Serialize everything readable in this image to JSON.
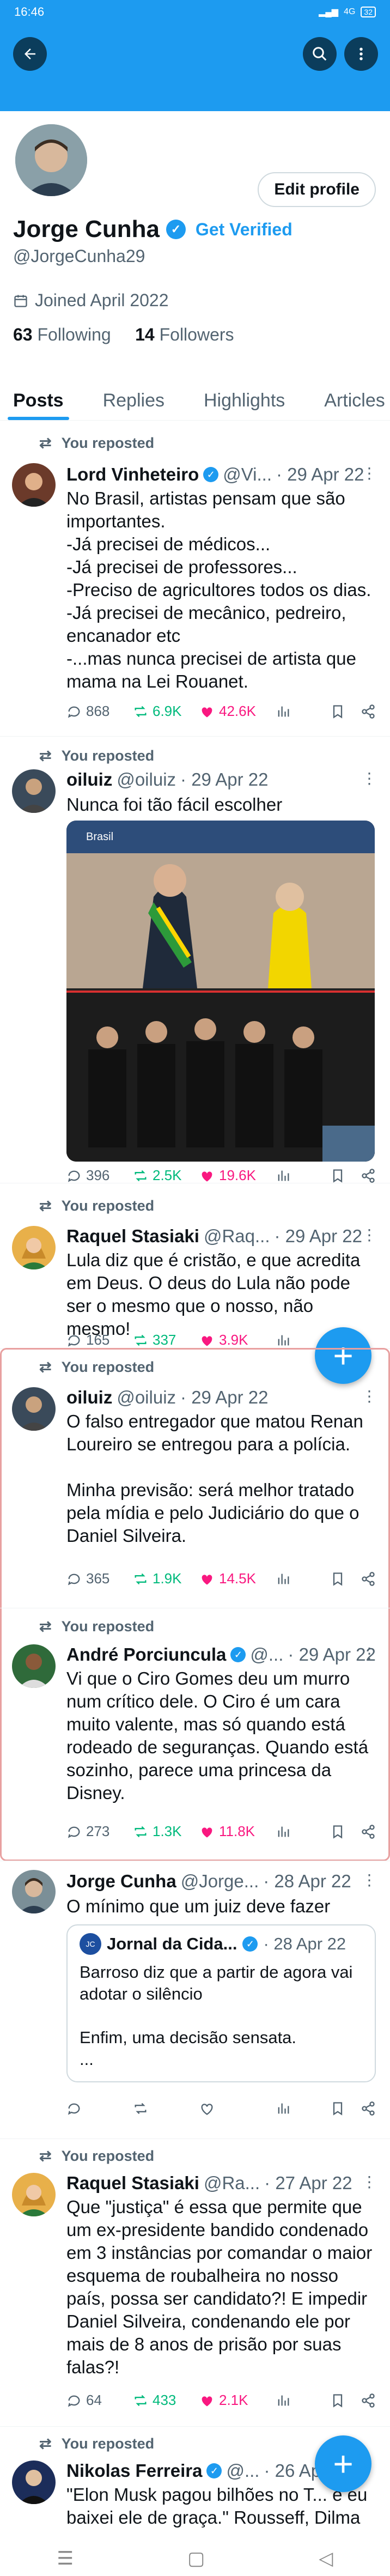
{
  "status": {
    "time": "16:46",
    "net": "4G",
    "battery": "32"
  },
  "profile": {
    "name": "Jorge Cunha",
    "get_verified": "Get Verified",
    "handle": "@JorgeCunha29",
    "joined": "Joined April 2022",
    "following_count": "63",
    "following_label": "Following",
    "followers_count": "14",
    "followers_label": "Followers",
    "edit_label": "Edit profile"
  },
  "tabs": [
    "Posts",
    "Replies",
    "Highlights",
    "Articles"
  ],
  "you_reposted": "You reposted",
  "posts": [
    {
      "name": "Lord Vinheteiro",
      "handle": "@Vi...",
      "date": "· 29 Apr 22",
      "text": "No Brasil, artistas pensam que são importantes.\n-Já precisei de médicos...\n-Já precisei de professores...\n-Preciso de agricultores todos os dias.\n-Já precisei de mecânico, pedreiro, encanador etc\n-...mas nunca precisei de artista que mama na Lei Rouanet.",
      "replies": "868",
      "reposts": "6.9K",
      "likes": "42.6K"
    },
    {
      "name": "oiluiz",
      "handle": "@oiluiz",
      "date": "· 29 Apr 22",
      "text": "Nunca foi tão fácil escolher",
      "replies": "396",
      "reposts": "2.5K",
      "likes": "19.6K",
      "photo_caption": "Brasil"
    },
    {
      "name": "Raquel Stasiaki",
      "handle": "@Raq...",
      "date": "· 29 Apr 22",
      "text": "Lula diz que é cristão, e que acredita em Deus. O deus do Lula não pode ser o mesmo que o nosso, não mesmo!",
      "replies": "165",
      "reposts": "337",
      "likes": "3.9K"
    },
    {
      "name": "oiluiz",
      "handle": "@oiluiz",
      "date": "· 29 Apr 22",
      "text": "O falso entregador que matou Renan Loureiro se entregou para a polícia.\n\nMinha previsão: será melhor tratado pela mídia e pelo Judiciário do que o Daniel Silveira.",
      "replies": "365",
      "reposts": "1.9K",
      "likes": "14.5K"
    },
    {
      "name": "André Porciuncula",
      "handle": "@...",
      "date": "· 29 Apr 22",
      "text": "Vi que o Ciro Gomes deu um murro num crítico dele. O Ciro é um cara muito valente, mas só quando está rodeado de seguranças. Quando está sozinho, parece uma princesa da Disney.",
      "replies": "273",
      "reposts": "1.3K",
      "likes": "11.8K"
    },
    {
      "name": "Jorge Cunha",
      "handle": "@Jorge...",
      "date": "· 28 Apr 22",
      "text": "O mínimo que um juiz deve fazer",
      "quote_name": "Jornal da Cida...",
      "quote_date": "· 28 Apr 22",
      "quote_text": "Barroso diz que a partir de agora vai adotar o silêncio\n\nEnfim, uma decisão sensata.\n..."
    },
    {
      "name": "Raquel Stasiaki",
      "handle": "@Ra...",
      "date": "· 27 Apr 22",
      "text": "Que \"justiça\" é essa que permite que um ex-presidente bandido condenado em 3 instâncias por comandar o maior esquema de roubalheira no nosso país, possa ser candidato?! E impedir Daniel Silveira, condenando ele por mais de 8 anos de prisão por suas falas?!",
      "replies": "64",
      "reposts": "433",
      "likes": "2.1K"
    },
    {
      "name": "Nikolas Ferreira",
      "handle": "@...",
      "date": "· 26 Apr",
      "text": "\"Elon Musk pagou bilhões no T... e eu baixei ele de graça.\" Rousseff, Dilma"
    }
  ],
  "colors": {
    "brand": "#1d9bf0",
    "repost": "#00ba7c",
    "like": "#f91880"
  }
}
